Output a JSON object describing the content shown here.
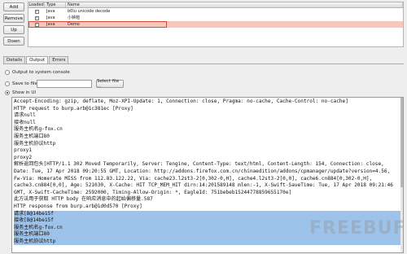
{
  "buttons": {
    "add": "Add",
    "remove": "Remove",
    "up": "Up",
    "down": "Down"
  },
  "extension_table": {
    "columns": [
      "Loaded",
      "Type",
      "Name"
    ],
    "rows": [
      {
        "loaded": true,
        "type": "Java",
        "name": "b0lu unicode decode"
      },
      {
        "loaded": true,
        "type": "Java",
        "name": "小钟馗"
      },
      {
        "loaded": true,
        "type": "Java",
        "name": "Demo",
        "selected": true
      }
    ]
  },
  "tabs": [
    "Details",
    "Output",
    "Errors"
  ],
  "active_tab": "Output",
  "output_options": {
    "system_console": "Output to system console",
    "save_to_file": "Save to file:",
    "select_file": "Select file ...",
    "show_in_ui": "Show in UI",
    "selected": "Show in UI"
  },
  "output_lines": [
    "Accept-Encoding: gzip, deflate, Moz-XPI-Update: 1, Connection: close, Pragma: no-cache, Cache-Control: no-cache]",
    "HTTP request to burp.arb@1c381ec [Proxy]",
    "请求null",
    "接收null",
    "服务主机名g-fox.cn",
    "服务主机端口80",
    "服务主机协议http",
    "proxy1",
    "proxy2",
    "解析返回包头[HTTP/1.1 302 Moved Temporarily, Server: Tengine, Content-Type: text/html, Content-Length: 154, Connection: close,",
    "Date: Tue, 17 Apr 2018 09:20:55 GMT, Location: http://addons.firefox.com.cn/chinaedition/addons/cpmanager/update?version=4.56,",
    "Fw-Via: Homerate MISS from 112.83.122.22, Via: cache23.l2st3-2[0,302-0,H], cache4.l2st3-2[0,0], cache6.cn884[0,302-0,H],",
    "cache3.cn884[0,0], Age: 521030, X-Cache: HIT TCP_MEM_HIT dirn:14:201589148 mlen:-1, X-Swift-SaveTime: Tue, 17 Apr 2018 09:21:46",
    "GMT, X-Swift-CacheTime: 2592000, Timing-Allow-Origin: *, EagleId: 751bebeb15244778859655170e]",
    "此方法用于获取 HTTP body 在响应消息中的起始偏移量.587",
    "HTTP response from burp.arb@1d0d570 [Proxy]",
    "请求[B@14be15f",
    "接收[B@14be15f",
    "服务主机名g-fox.cn",
    "服务主机端口80",
    "服务主机协议http"
  ],
  "highlighted_from_line": 16,
  "watermark": "FREEBUF"
}
